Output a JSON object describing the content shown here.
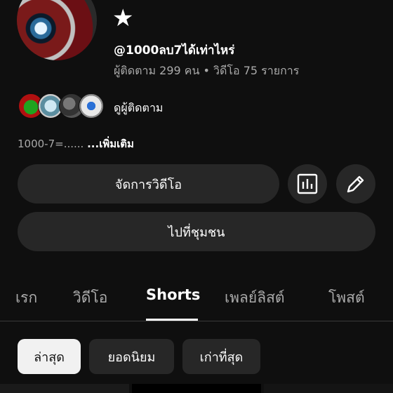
{
  "channel": {
    "name": "★",
    "handle": "@1000ลบ7ได้เท่าไหร่",
    "meta": "ผู้ติดตาม 299 คน • วิดีโอ 75 รายการ",
    "see_subscriptions": "ดูผู้ติดตาม",
    "description": "1000-7=......",
    "more_label": "...เพิ่มเติม"
  },
  "buttons": {
    "manage_videos": "จัดการวิดีโอ",
    "analytics_icon": "bar-chart-icon",
    "edit_icon": "pencil-icon",
    "go_to_community": "ไปที่ชุมชน"
  },
  "tabs": [
    "เรก",
    "วิดีโอ",
    "Shorts",
    "เพลย์ลิสต์",
    "โพสต์"
  ],
  "active_tab": "Shorts",
  "filters": [
    "ล่าสุด",
    "ยอดนิยม",
    "เก่าที่สุด"
  ],
  "selected_filter": "ล่าสุด",
  "colors": {
    "background": "#0f0f0f",
    "surface": "#272727",
    "text": "#ffffff",
    "muted": "#aaaaaa",
    "chip_selected": "#f1f1f1"
  }
}
